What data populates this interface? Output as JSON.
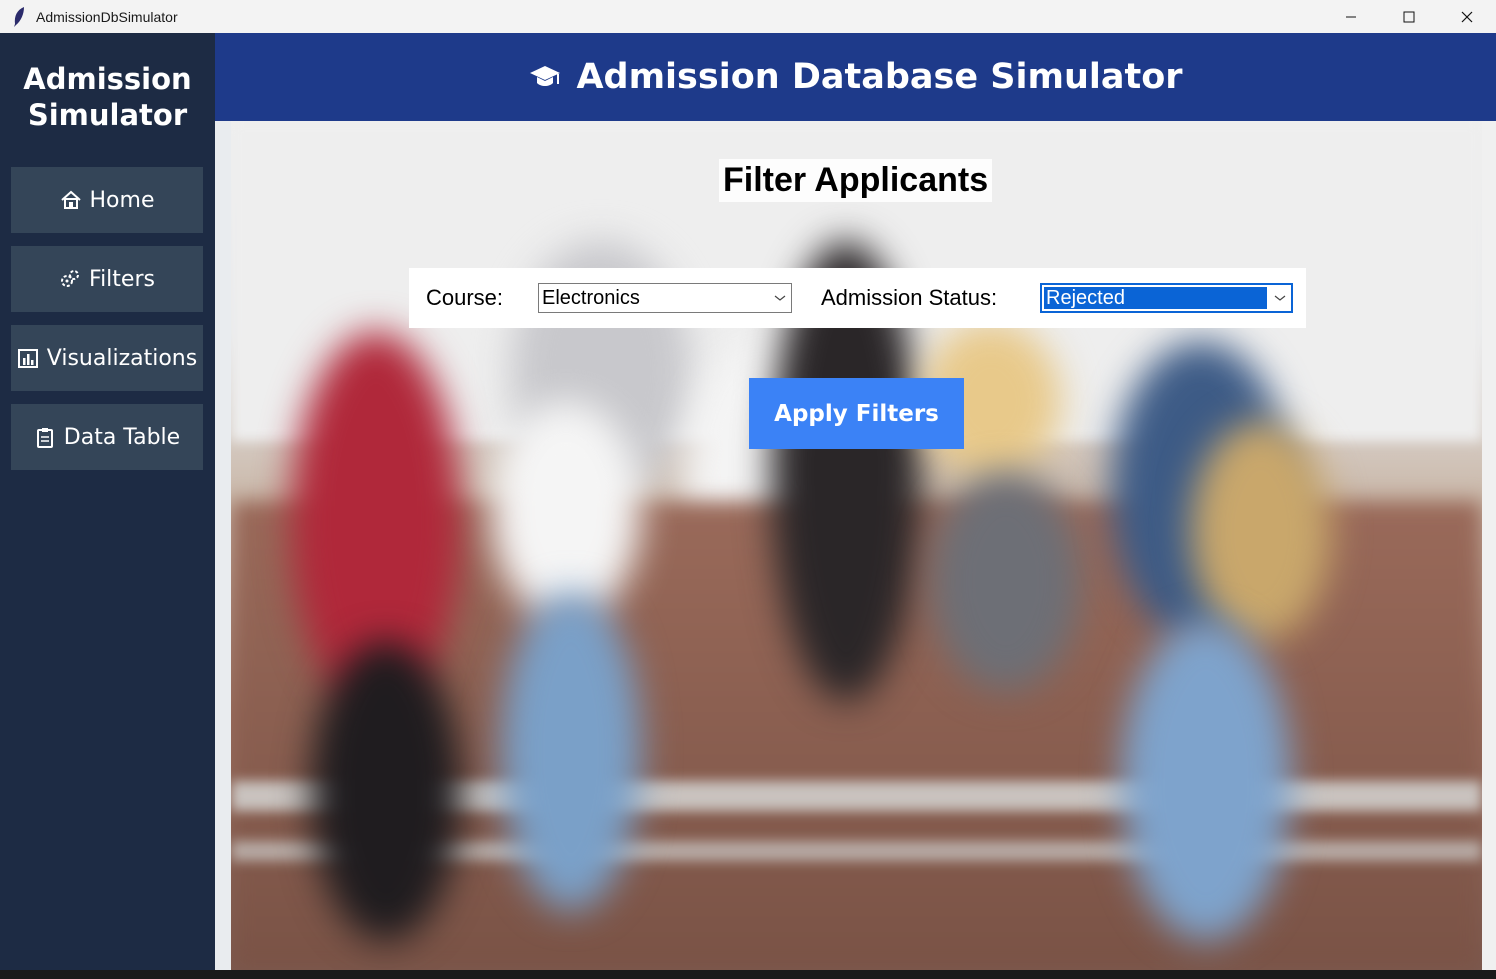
{
  "window": {
    "title": "AdmissionDbSimulator",
    "controls": {
      "minimize": "—",
      "maximize": "☐",
      "close": "✕"
    }
  },
  "sidebar": {
    "title_line1": "Admission",
    "title_line2": "Simulator",
    "items": [
      {
        "label": "Home",
        "icon": "house-icon"
      },
      {
        "label": "Filters",
        "icon": "gears-icon"
      },
      {
        "label": "Visualizations",
        "icon": "bar-chart-icon"
      },
      {
        "label": "Data Table",
        "icon": "clipboard-icon"
      }
    ]
  },
  "header": {
    "title": "Admission Database Simulator",
    "icon": "graduation-cap-icon"
  },
  "main": {
    "section_title": "Filter Applicants",
    "filters": {
      "course_label": "Course:",
      "course_value": "Electronics",
      "status_label": "Admission Status:",
      "status_value": "Rejected"
    },
    "apply_label": "Apply Filters"
  },
  "colors": {
    "sidebar_bg": "#1d2b44",
    "nav_button_bg": "#344558",
    "header_bg": "#1e3a8a",
    "apply_button_bg": "#3b82f6",
    "select_highlight": "#0a64d6"
  }
}
